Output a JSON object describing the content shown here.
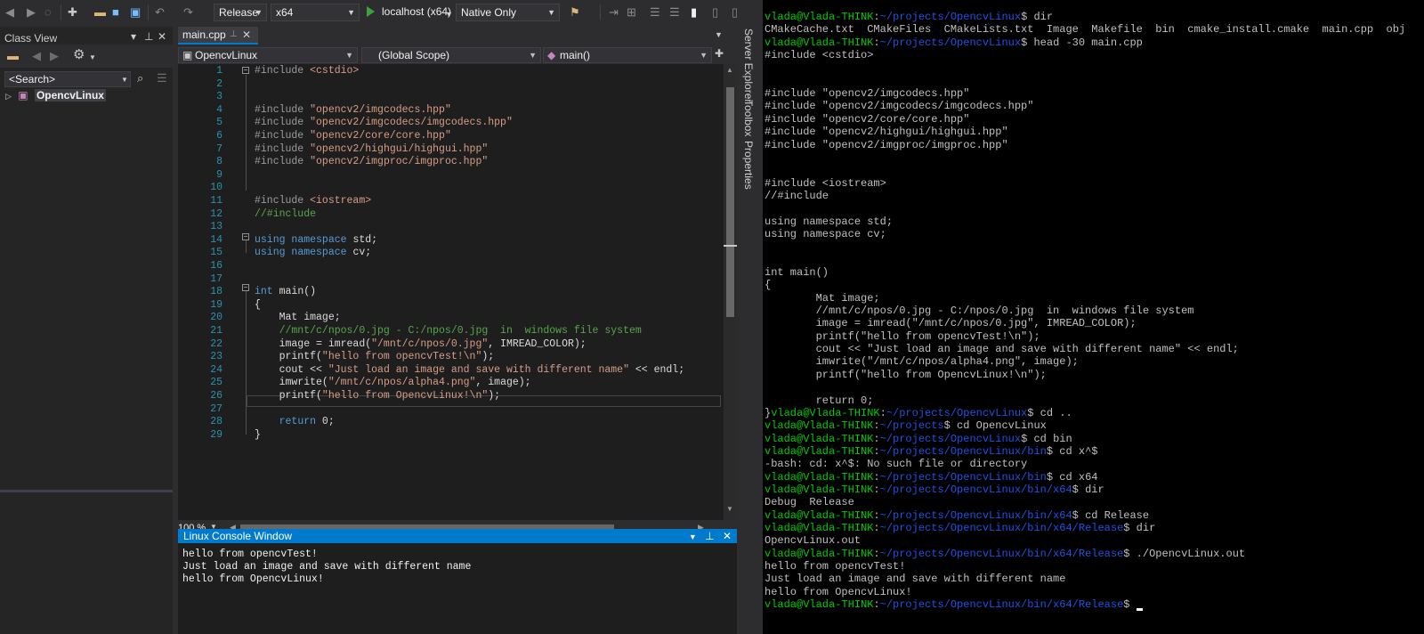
{
  "toolbar": {
    "config": "Release",
    "platform": "x64",
    "run_target": "localhost (x64)",
    "debugger": "Native Only"
  },
  "class_view": {
    "title": "Class View",
    "search_placeholder": "<Search>",
    "tree_root": "OpencvLinux"
  },
  "editor": {
    "tab": "main.cpp",
    "nav_project": "OpencvLinux",
    "nav_scope": "(Global Scope)",
    "nav_member": "main()",
    "zoom": "100 %",
    "code_lines": [
      "#include <cstdio>",
      "",
      "",
      "#include \"opencv2/imgcodecs.hpp\"",
      "#include \"opencv2/imgcodecs/imgcodecs.hpp\"",
      "#include \"opencv2/core/core.hpp\"",
      "#include \"opencv2/highgui/highgui.hpp\"",
      "#include \"opencv2/imgproc/imgproc.hpp\"",
      "",
      "",
      "#include <iostream>",
      "//#include",
      "",
      "using namespace std;",
      "using namespace cv;",
      "",
      "",
      "int main()",
      "{",
      "    Mat image;",
      "    //mnt/c/npos/0.jpg - C:/npos/0.jpg  in  windows file system",
      "    image = imread(\"/mnt/c/npos/0.jpg\", IMREAD_COLOR);",
      "    printf(\"hello from opencvTest!\\n\");",
      "    cout << \"Just load an image and save with different name\" << endl;",
      "    imwrite(\"/mnt/c/npos/alpha4.png\", image);",
      "    printf(\"hello from OpencvLinux!\\n\");",
      "",
      "    return 0;",
      "}"
    ]
  },
  "side_tabs": [
    "Server Explorer",
    "Toolbox",
    "Properties"
  ],
  "console": {
    "title": "Linux Console Window",
    "lines": [
      "hello from opencvTest!",
      "Just load an image and save with different name",
      "hello from OpencvLinux!"
    ]
  },
  "terminal": {
    "user": "vlada@Vlada-THINK",
    "lines": [
      {
        "type": "prompt",
        "path": "~/projects/OpencvLinux",
        "cmd": "dir"
      },
      {
        "type": "out",
        "text": "CMakeCache.txt  CMakeFiles  CMakeLists.txt  Image  Makefile  bin  cmake_install.cmake  main.cpp  obj"
      },
      {
        "type": "prompt",
        "path": "~/projects/OpencvLinux",
        "cmd": "head -30 main.cpp"
      },
      {
        "type": "out",
        "text": "#include <cstdio>"
      },
      {
        "type": "out",
        "text": ""
      },
      {
        "type": "out",
        "text": ""
      },
      {
        "type": "out",
        "text": "#include \"opencv2/imgcodecs.hpp\""
      },
      {
        "type": "out",
        "text": "#include \"opencv2/imgcodecs/imgcodecs.hpp\""
      },
      {
        "type": "out",
        "text": "#include \"opencv2/core/core.hpp\""
      },
      {
        "type": "out",
        "text": "#include \"opencv2/highgui/highgui.hpp\""
      },
      {
        "type": "out",
        "text": "#include \"opencv2/imgproc/imgproc.hpp\""
      },
      {
        "type": "out",
        "text": ""
      },
      {
        "type": "out",
        "text": ""
      },
      {
        "type": "out",
        "text": "#include <iostream>"
      },
      {
        "type": "out",
        "text": "//#include"
      },
      {
        "type": "out",
        "text": ""
      },
      {
        "type": "out",
        "text": "using namespace std;"
      },
      {
        "type": "out",
        "text": "using namespace cv;"
      },
      {
        "type": "out",
        "text": ""
      },
      {
        "type": "out",
        "text": ""
      },
      {
        "type": "out",
        "text": "int main()"
      },
      {
        "type": "out",
        "text": "{"
      },
      {
        "type": "out",
        "text": "        Mat image;"
      },
      {
        "type": "out",
        "text": "        //mnt/c/npos/0.jpg - C:/npos/0.jpg  in  windows file system"
      },
      {
        "type": "out",
        "text": "        image = imread(\"/mnt/c/npos/0.jpg\", IMREAD_COLOR);"
      },
      {
        "type": "out",
        "text": "        printf(\"hello from opencvTest!\\n\");"
      },
      {
        "type": "out",
        "text": "        cout << \"Just load an image and save with different name\" << endl;"
      },
      {
        "type": "out",
        "text": "        imwrite(\"/mnt/c/npos/alpha4.png\", image);"
      },
      {
        "type": "out",
        "text": "        printf(\"hello from OpencvLinux!\\n\");"
      },
      {
        "type": "out",
        "text": ""
      },
      {
        "type": "out",
        "text": "        return 0;"
      },
      {
        "type": "prompt",
        "pre": "}",
        "path": "~/projects/OpencvLinux",
        "cmd": "cd .."
      },
      {
        "type": "prompt",
        "path": "~/projects",
        "cmd": "cd OpencvLinux"
      },
      {
        "type": "prompt",
        "path": "~/projects/OpencvLinux",
        "cmd": "cd bin"
      },
      {
        "type": "prompt",
        "path": "~/projects/OpencvLinux/bin",
        "cmd": "cd x^$"
      },
      {
        "type": "out",
        "text": "-bash: cd: x^$: No such file or directory"
      },
      {
        "type": "prompt",
        "path": "~/projects/OpencvLinux/bin",
        "cmd": "cd x64"
      },
      {
        "type": "prompt",
        "path": "~/projects/OpencvLinux/bin/x64",
        "cmd": "dir"
      },
      {
        "type": "out",
        "text": "Debug  Release"
      },
      {
        "type": "prompt",
        "path": "~/projects/OpencvLinux/bin/x64",
        "cmd": "cd Release"
      },
      {
        "type": "prompt",
        "path": "~/projects/OpencvLinux/bin/x64/Release",
        "cmd": "dir"
      },
      {
        "type": "out",
        "text": "OpencvLinux.out"
      },
      {
        "type": "prompt",
        "path": "~/projects/OpencvLinux/bin/x64/Release",
        "cmd": "./OpencvLinux.out"
      },
      {
        "type": "out",
        "text": "hello from opencvTest!"
      },
      {
        "type": "out",
        "text": "Just load an image and save with different name"
      },
      {
        "type": "out",
        "text": "hello from OpencvLinux!"
      },
      {
        "type": "prompt",
        "path": "~/projects/OpencvLinux/bin/x64/Release",
        "cmd": "",
        "cursor": true
      }
    ]
  }
}
